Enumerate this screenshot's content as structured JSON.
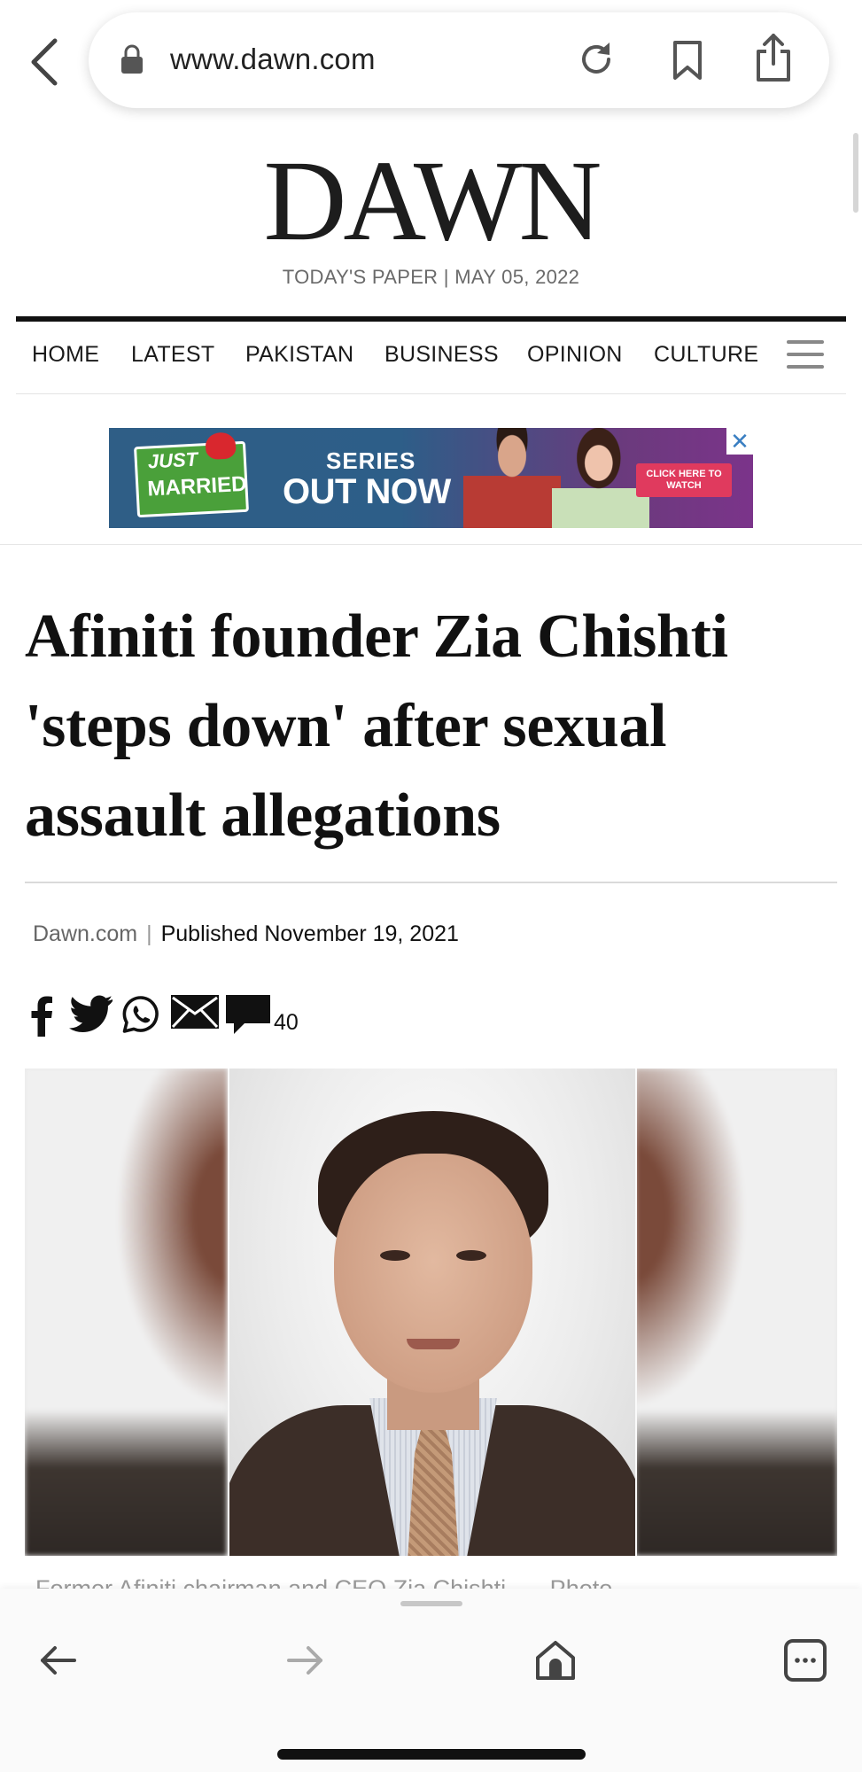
{
  "browser": {
    "url": "www.dawn.com",
    "back_icon": "chevron-left-icon",
    "lock_icon": "lock-icon",
    "reload_icon": "reload-icon",
    "bookmark_icon": "bookmark-icon",
    "share_icon": "share-icon"
  },
  "masthead": {
    "logo": "DAWN",
    "paper_date": "TODAY'S PAPER | MAY 05, 2022"
  },
  "nav": {
    "items": [
      "HOME",
      "LATEST",
      "PAKISTAN",
      "BUSINESS",
      "OPINION",
      "CULTURE"
    ],
    "menu_icon": "hamburger-menu-icon"
  },
  "ad": {
    "logo_top": "JUST",
    "logo_bottom": "MARRIED",
    "line1": "SERIES",
    "line2": "OUT NOW",
    "cta": "CLICK HERE TO WATCH",
    "close_label": "✕"
  },
  "article": {
    "headline": "Afiniti founder Zia Chishti 'steps down' after sexual assault allegations",
    "source": "Dawn.com",
    "separator": "|",
    "published": "Published November 19, 2021",
    "comment_count": "40",
    "share_icons": [
      "facebook-icon",
      "twitter-icon",
      "whatsapp-icon",
      "email-icon",
      "comment-icon"
    ],
    "caption": "Former Afiniti chairman and CEO Zia Chishti. — Photo"
  },
  "toolbar": {
    "icons": [
      "back-arrow-icon",
      "forward-arrow-icon",
      "home-icon",
      "tabs-icon"
    ]
  },
  "colors": {
    "accent": "#111111",
    "muted": "#6a6a6a",
    "ad_close": "#3a7fc2"
  }
}
